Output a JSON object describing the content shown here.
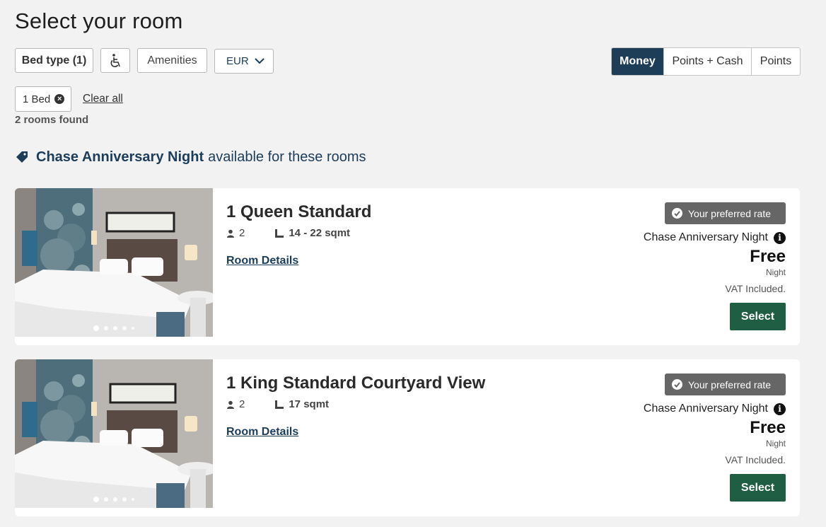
{
  "page": {
    "title": "Select your room"
  },
  "filters": {
    "bed_type": "Bed type (1)",
    "amenities": "Amenities",
    "currency": "EUR",
    "accessibility_icon": "wheelchair-icon"
  },
  "payment_modes": [
    {
      "label": "Money",
      "active": true
    },
    {
      "label": "Points + Cash",
      "active": false
    },
    {
      "label": "Points",
      "active": false
    }
  ],
  "active_filter": {
    "chip": "1 Bed",
    "clear": "Clear all"
  },
  "results": {
    "count": "2 rooms found"
  },
  "promo": {
    "name": "Chase Anniversary Night",
    "suffix": "available for these rooms"
  },
  "rooms": [
    {
      "name": "1 Queen Standard",
      "guests": "2",
      "size": "14 - 22 sqmt",
      "details": "Room Details",
      "badge": "Your preferred rate",
      "rate_name": "Chase Anniversary Night",
      "price": "Free",
      "per": "Night",
      "vat": "VAT Included.",
      "select": "Select"
    },
    {
      "name": "1 King Standard Courtyard View",
      "guests": "2",
      "size": "17 sqmt",
      "details": "Room Details",
      "badge": "Your preferred rate",
      "rate_name": "Chase Anniversary Night",
      "price": "Free",
      "per": "Night",
      "vat": "VAT Included.",
      "select": "Select"
    }
  ],
  "colors": {
    "primary": "#1e3d57",
    "select": "#1f5e43",
    "badge": "#666666"
  }
}
